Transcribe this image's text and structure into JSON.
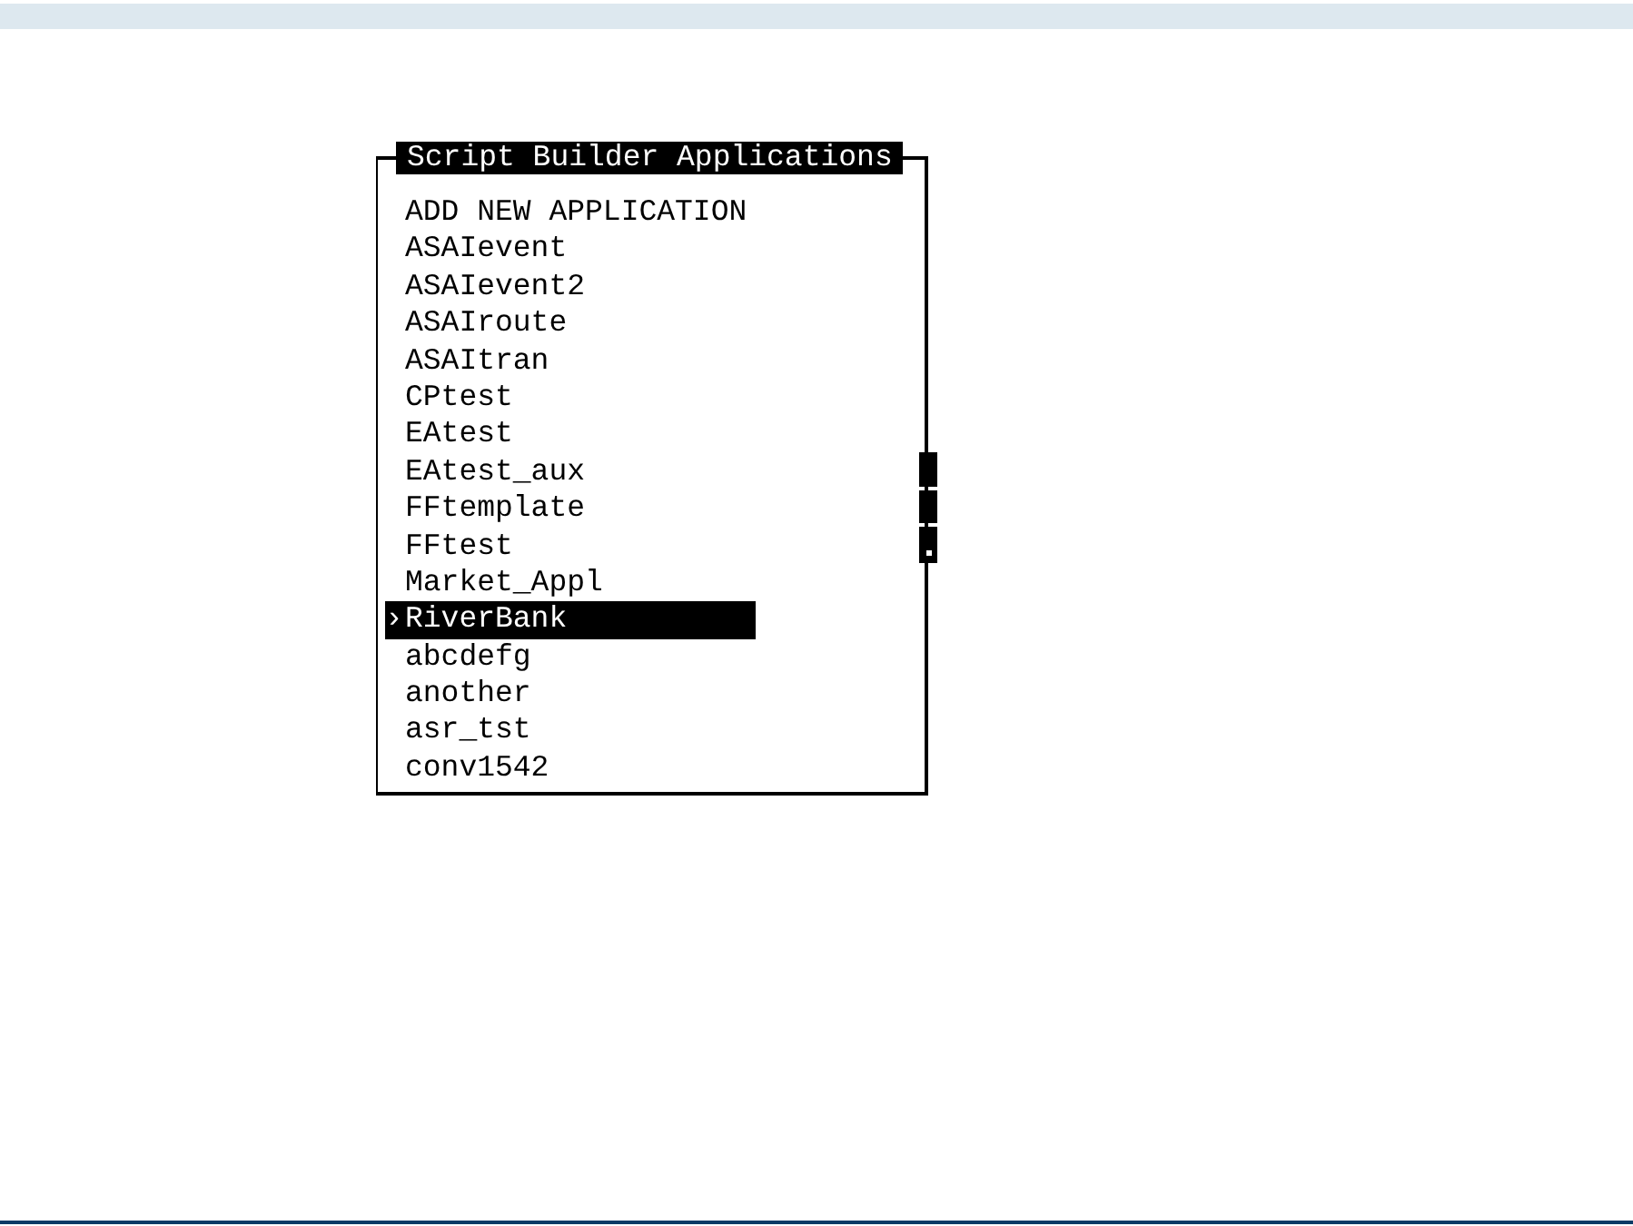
{
  "panel": {
    "title": "Script Builder Applications",
    "selection_marker": "›",
    "items": [
      {
        "label": "ADD NEW APPLICATION",
        "selected": false
      },
      {
        "label": "ASAIevent",
        "selected": false
      },
      {
        "label": "ASAIevent2",
        "selected": false
      },
      {
        "label": "ASAIroute",
        "selected": false
      },
      {
        "label": "ASAItran",
        "selected": false
      },
      {
        "label": "CPtest",
        "selected": false
      },
      {
        "label": "EAtest",
        "selected": false
      },
      {
        "label": "EAtest_aux",
        "selected": false
      },
      {
        "label": "FFtemplate",
        "selected": false
      },
      {
        "label": "FFtest",
        "selected": false
      },
      {
        "label": "Market_Appl",
        "selected": false
      },
      {
        "label": "RiverBank",
        "selected": true
      },
      {
        "label": "abcdefg",
        "selected": false
      },
      {
        "label": "another",
        "selected": false
      },
      {
        "label": "asr_tst",
        "selected": false
      },
      {
        "label": "conv1542",
        "selected": false
      }
    ]
  }
}
